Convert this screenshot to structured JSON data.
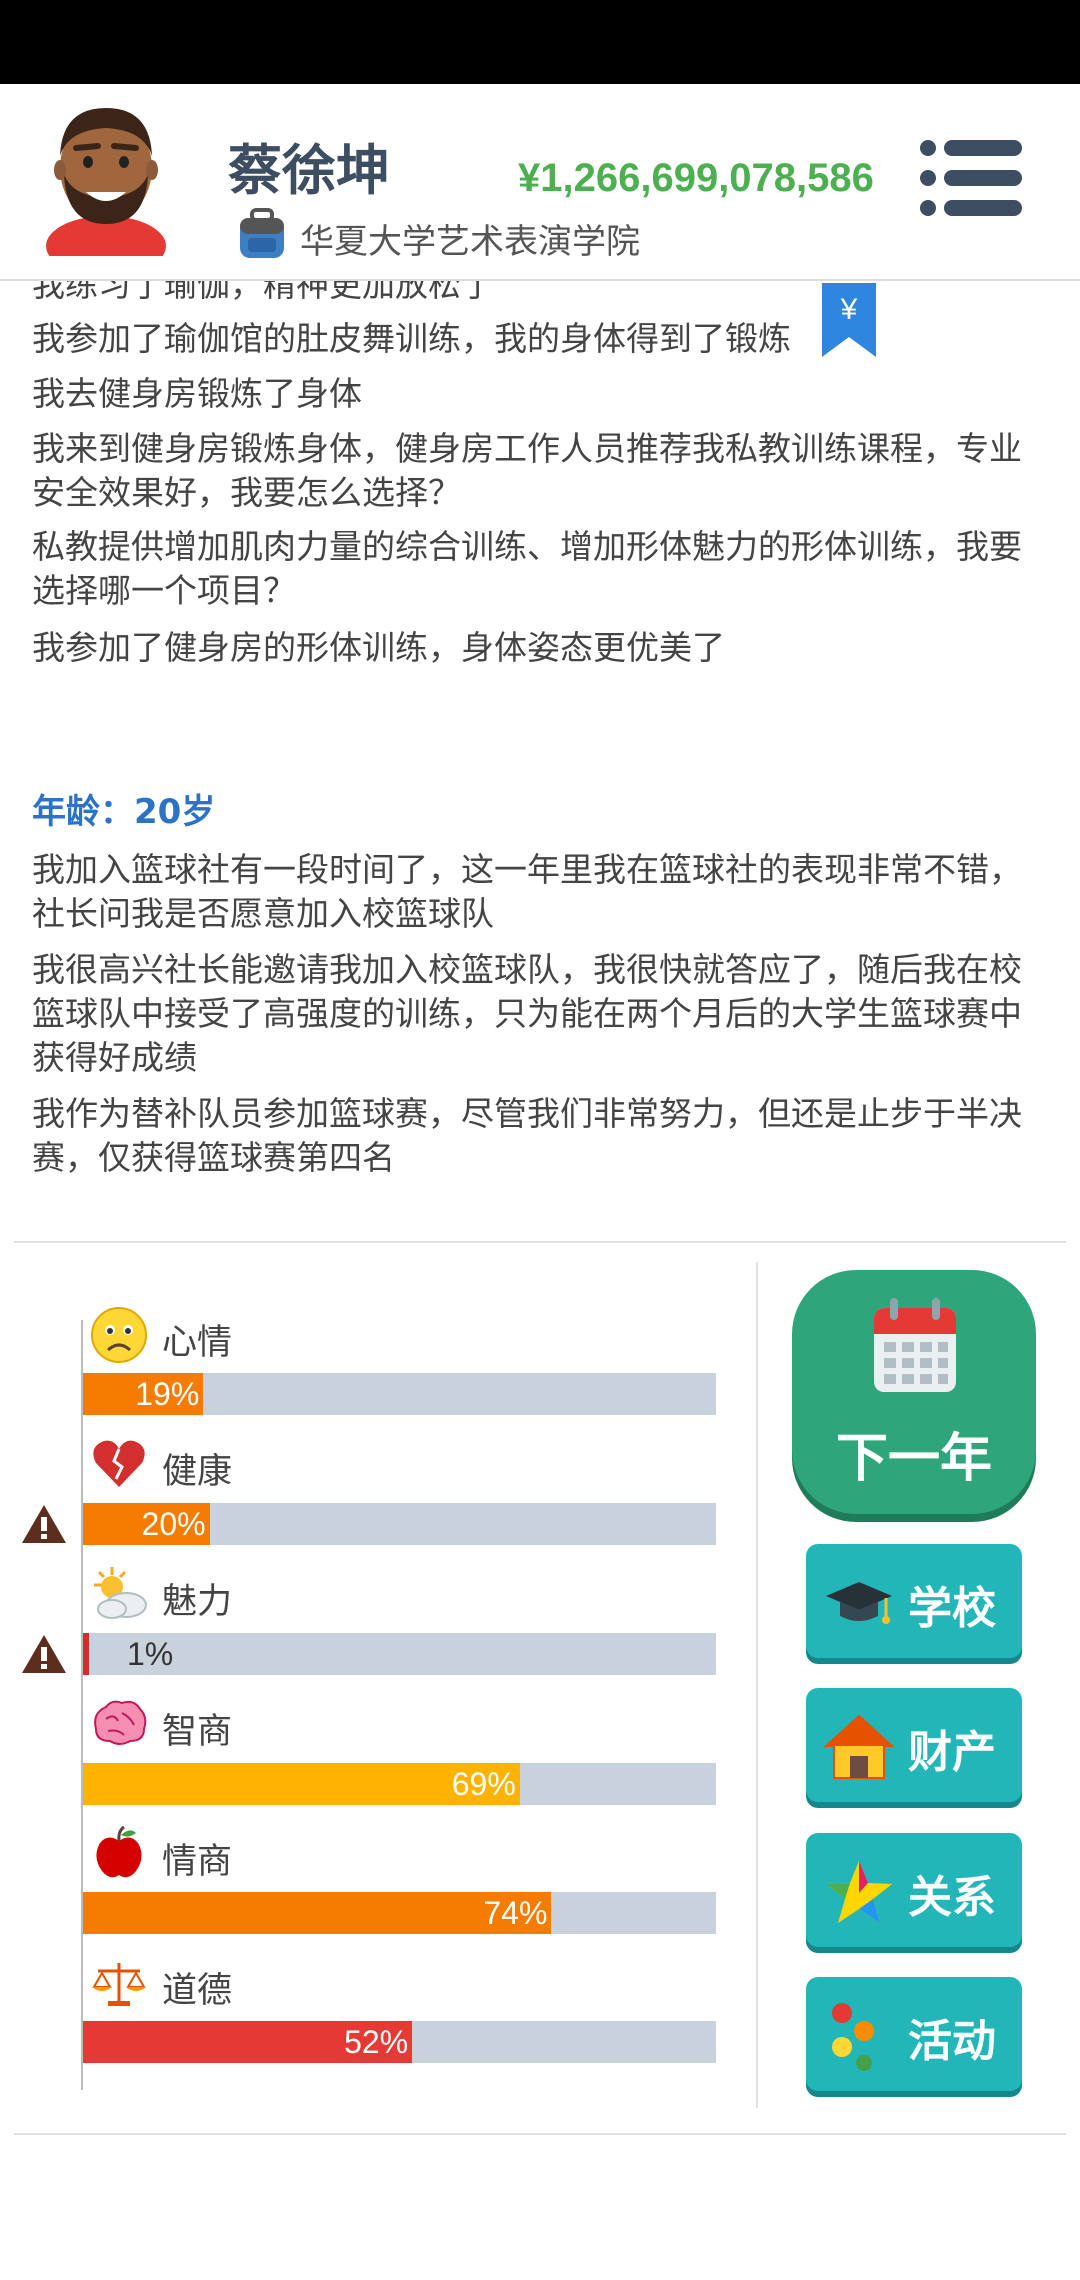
{
  "header": {
    "name": "蔡徐坤",
    "school": "华夏大学艺术表演学院",
    "money": "¥1,266,699,078,586",
    "bookmark_symbol": "¥"
  },
  "log": {
    "partial_top": "我练习了瑜伽，精神更加放松了",
    "lines_1": [
      "我参加了瑜伽馆的肚皮舞训练，我的身体得到了锻炼",
      "我去健身房锻炼了身体",
      "我来到健身房锻炼身体，健身房工作人员推荐我私教训练课程，专业安全效果好，我要怎么选择？",
      "私教提供增加肌肉力量的综合训练、增加形体魅力的形体训练，我要选择哪一个项目？",
      "我参加了健身房的形体训练，身体姿态更优美了"
    ],
    "age_heading": "年龄：20岁",
    "lines_2": [
      "我加入篮球社有一段时间了，这一年里我在篮球社的表现非常不错，社长问我是否愿意加入校篮球队",
      "我很高兴社长能邀请我加入校篮球队，我很快就答应了，随后我在校篮球队中接受了高强度的训练，只为能在两个月后的大学生篮球赛中获得好成绩",
      "我作为替补队员参加篮球赛，尽管我们非常努力，但还是止步于半决赛，仅获得篮球赛第四名"
    ]
  },
  "stats": [
    {
      "label": "心情",
      "icon": "sad-face-icon",
      "percent": 19,
      "pct_text": "19%",
      "color": "#f57c00",
      "warning": false
    },
    {
      "label": "健康",
      "icon": "broken-heart-icon",
      "percent": 20,
      "pct_text": "20%",
      "color": "#f57c00",
      "warning": true
    },
    {
      "label": "魅力",
      "icon": "sun-cloud-icon",
      "percent": 1,
      "pct_text": "1%",
      "color": "#d32f2f",
      "warning": true
    },
    {
      "label": "智商",
      "icon": "brain-icon",
      "percent": 69,
      "pct_text": "69%",
      "color": "#ffb300",
      "warning": false
    },
    {
      "label": "情商",
      "icon": "apple-icon",
      "percent": 74,
      "pct_text": "74%",
      "color": "#f57c00",
      "warning": false
    },
    {
      "label": "道德",
      "icon": "scales-icon",
      "percent": 52,
      "pct_text": "52%",
      "color": "#e53935",
      "warning": false
    }
  ],
  "actions": {
    "next_year": "下一年",
    "school": "学校",
    "property": "财产",
    "relations": "关系",
    "activities": "活动"
  },
  "colors": {
    "money": "#4caf50",
    "next_year_bg": "#2ea57b",
    "side_button_bg": "#22b6b8",
    "age_heading": "#2c72c6"
  }
}
